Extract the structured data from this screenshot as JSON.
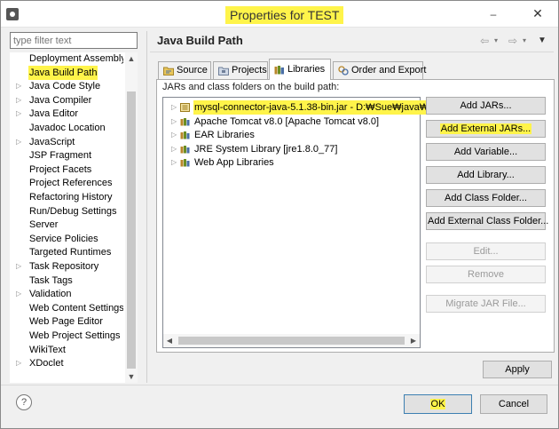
{
  "window": {
    "title": "Properties for TEST",
    "icon": "eclipse-app-icon",
    "minimize_glyph": "–",
    "close_glyph": "✕"
  },
  "colors": {
    "highlight": "#fff44a",
    "window_bg": "#f0f0f0",
    "button_bg": "#e1e1e1",
    "default_button_border": "#3c7fb1"
  },
  "sidebar": {
    "filter_placeholder": "type filter text",
    "items": [
      {
        "label": "Deployment Assembly",
        "expandable": false,
        "highlighted": false
      },
      {
        "label": "Java Build Path",
        "expandable": false,
        "highlighted": true
      },
      {
        "label": "Java Code Style",
        "expandable": true,
        "highlighted": false
      },
      {
        "label": "Java Compiler",
        "expandable": true,
        "highlighted": false
      },
      {
        "label": "Java Editor",
        "expandable": true,
        "highlighted": false
      },
      {
        "label": "Javadoc Location",
        "expandable": false,
        "highlighted": false
      },
      {
        "label": "JavaScript",
        "expandable": true,
        "highlighted": false
      },
      {
        "label": "JSP Fragment",
        "expandable": false,
        "highlighted": false
      },
      {
        "label": "Project Facets",
        "expandable": false,
        "highlighted": false
      },
      {
        "label": "Project References",
        "expandable": false,
        "highlighted": false
      },
      {
        "label": "Refactoring History",
        "expandable": false,
        "highlighted": false
      },
      {
        "label": "Run/Debug Settings",
        "expandable": false,
        "highlighted": false
      },
      {
        "label": "Server",
        "expandable": false,
        "highlighted": false
      },
      {
        "label": "Service Policies",
        "expandable": false,
        "highlighted": false
      },
      {
        "label": "Targeted Runtimes",
        "expandable": false,
        "highlighted": false
      },
      {
        "label": "Task Repository",
        "expandable": true,
        "highlighted": false
      },
      {
        "label": "Task Tags",
        "expandable": false,
        "highlighted": false
      },
      {
        "label": "Validation",
        "expandable": true,
        "highlighted": false
      },
      {
        "label": "Web Content Settings",
        "expandable": false,
        "highlighted": false
      },
      {
        "label": "Web Page Editor",
        "expandable": false,
        "highlighted": false
      },
      {
        "label": "Web Project Settings",
        "expandable": false,
        "highlighted": false
      },
      {
        "label": "WikiText",
        "expandable": false,
        "highlighted": false
      },
      {
        "label": "XDoclet",
        "expandable": true,
        "highlighted": false
      }
    ]
  },
  "header": {
    "title": "Java Build Path",
    "back_glyph": "⇦",
    "forward_glyph": "⇨",
    "dropdown_glyph": "▾",
    "view_menu_glyph": "▼"
  },
  "tabs": [
    {
      "label": "Source",
      "icon": "source-folder-icon",
      "active": false
    },
    {
      "label": "Projects",
      "icon": "projects-icon",
      "active": false
    },
    {
      "label": "Libraries",
      "icon": "libraries-icon",
      "active": true
    },
    {
      "label": "Order and Export",
      "icon": "order-export-icon",
      "active": false
    }
  ],
  "libraries": {
    "caption": "JARs and class folders on the build path:",
    "items": [
      {
        "label": "mysql-connector-java-5.1.38-bin.jar - D:₩Sue₩java₩j",
        "icon": "jar-icon",
        "highlighted": true
      },
      {
        "label": "Apache Tomcat v8.0 [Apache Tomcat v8.0]",
        "icon": "library-icon",
        "highlighted": false
      },
      {
        "label": "EAR Libraries",
        "icon": "library-icon",
        "highlighted": false
      },
      {
        "label": "JRE System Library [jre1.8.0_77]",
        "icon": "library-icon",
        "highlighted": false
      },
      {
        "label": "Web App Libraries",
        "icon": "library-icon",
        "highlighted": false
      }
    ]
  },
  "buttons": {
    "add_jars": "Add JARs...",
    "add_external_jars": "Add External JARs...",
    "add_variable": "Add Variable...",
    "add_library": "Add Library...",
    "add_class_folder": "Add Class Folder...",
    "add_external_class_folder": "Add External Class Folder...",
    "edit": "Edit...",
    "remove": "Remove",
    "migrate_jar": "Migrate JAR File...",
    "apply": "Apply",
    "ok": "OK",
    "cancel": "Cancel"
  },
  "help_glyph": "?"
}
